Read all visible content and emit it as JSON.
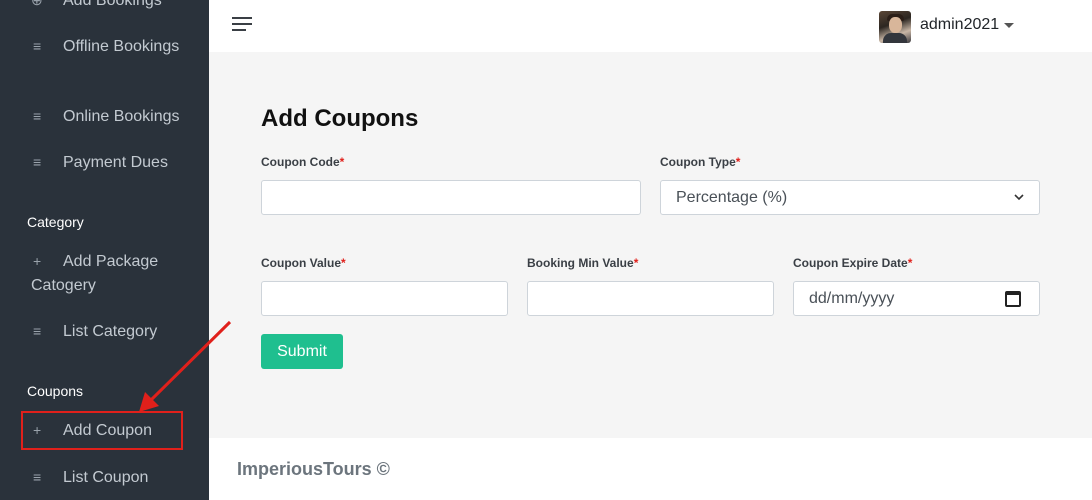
{
  "sidebar": {
    "items": [
      {
        "icon": "add-icon",
        "glyph": "⊕",
        "label": "Add Bookings"
      },
      {
        "icon": "list-icon",
        "glyph": "≡",
        "label": "Offline Bookings"
      },
      {
        "icon": "list-icon",
        "glyph": "≡",
        "label": "Online Bookings"
      },
      {
        "icon": "list-icon",
        "glyph": "≡",
        "label": "Payment Dues"
      },
      {
        "icon": "plus-icon",
        "glyph": "+",
        "label": "Add Package Catogery"
      },
      {
        "icon": "list-icon",
        "glyph": "≡",
        "label": "List Category"
      },
      {
        "icon": "plus-icon",
        "glyph": "+",
        "label": "Add Coupon"
      },
      {
        "icon": "list-icon",
        "glyph": "≡",
        "label": "List Coupon"
      }
    ],
    "sections": [
      "Category",
      "Coupons"
    ]
  },
  "topbar": {
    "username": "admin2021"
  },
  "form": {
    "title": "Add Coupons",
    "required_mark": "*",
    "coupon_code_label": "Coupon Code",
    "coupon_type_label": "Coupon Type",
    "coupon_type_value": "Percentage (%)",
    "coupon_value_label": "Coupon Value",
    "booking_min_label": "Booking Min Value",
    "expire_label": "Coupon Expire Date",
    "expire_placeholder": "dd/mm/yyyy",
    "submit_label": "Submit"
  },
  "footer": {
    "text": "ImperiousTours ©"
  },
  "colors": {
    "sidebar_bg": "#2a323b",
    "accent": "#1fbf8f",
    "required": "#e0201b",
    "annotation": "#e0201b"
  }
}
